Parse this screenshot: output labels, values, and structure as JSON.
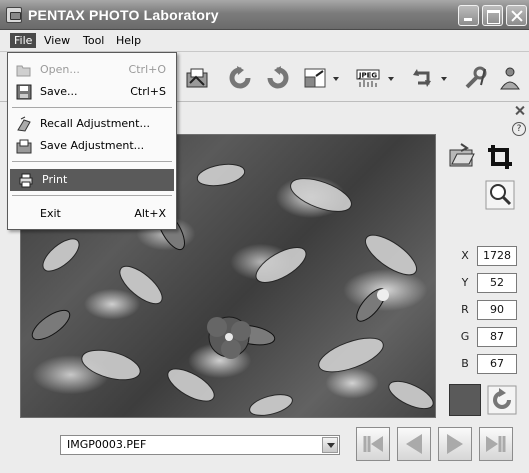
{
  "window": {
    "title": "PENTAX PHOTO Laboratory"
  },
  "menubar": {
    "file": "File",
    "view": "View",
    "tool": "Tool",
    "help": "Help"
  },
  "file_menu": {
    "open": {
      "label": "Open...",
      "shortcut": "Ctrl+O",
      "enabled": false,
      "icon": "open-folder-icon"
    },
    "save": {
      "label": "Save...",
      "shortcut": "Ctrl+S",
      "icon": "floppy-disk-icon"
    },
    "recall": {
      "label": "Recall Adjustment...",
      "icon": "recall-adjustment-icon"
    },
    "save_adj": {
      "label": "Save Adjustment...",
      "icon": "save-adjustment-icon"
    },
    "print": {
      "label": "Print",
      "icon": "printer-icon"
    },
    "exit": {
      "label": "Exit",
      "shortcut": "Alt+X"
    }
  },
  "panel": {
    "help_glyph": "?"
  },
  "readout": {
    "x": {
      "label": "X",
      "value": "1728"
    },
    "y": {
      "label": "Y",
      "value": "52"
    },
    "r": {
      "label": "R",
      "value": "90"
    },
    "g": {
      "label": "G",
      "value": "87"
    },
    "b": {
      "label": "B",
      "value": "67"
    }
  },
  "colors": {
    "swatch": "#5a5a5a",
    "accent": "#4a4a4a"
  },
  "file_selector": {
    "value": "IMGP0003.PEF"
  }
}
